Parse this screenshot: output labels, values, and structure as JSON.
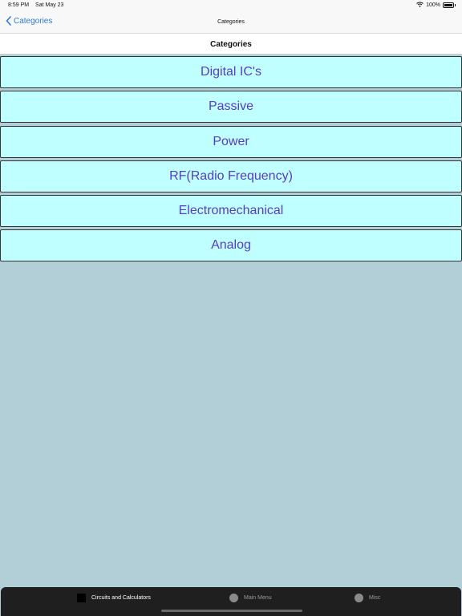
{
  "status_bar": {
    "time": "8:59 PM",
    "date": "Sat May 23",
    "battery_text": "100%",
    "battery_level": 1.0
  },
  "nav": {
    "back_label": "Categories",
    "title": "Categories"
  },
  "section_header": "Categories",
  "categories": [
    {
      "label": "Digital IC's"
    },
    {
      "label": "Passive"
    },
    {
      "label": "Power"
    },
    {
      "label": "RF(Radio Frequency)"
    },
    {
      "label": "Electromechanical"
    },
    {
      "label": "Analog"
    }
  ],
  "tabs": [
    {
      "label": "Circuits and Calculators",
      "icon": "square-icon",
      "selected": true
    },
    {
      "label": "Main Menu",
      "icon": "circle-icon",
      "selected": false
    },
    {
      "label": "Misc",
      "icon": "circle-icon",
      "selected": false
    }
  ],
  "colors": {
    "background": "#b2cfd8",
    "button_fill": "#bfffff",
    "button_text": "#5a3cc4",
    "accent": "#2a7bd9",
    "tab_bar": "#1f1f1f"
  }
}
